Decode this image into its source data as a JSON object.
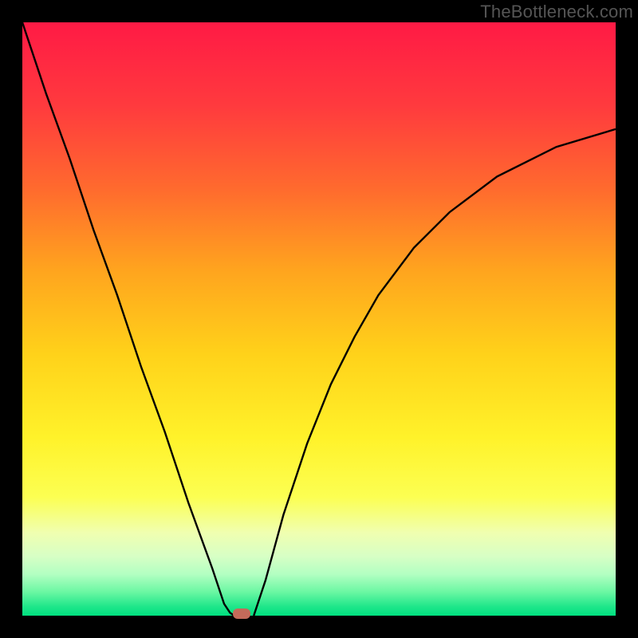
{
  "watermark": "TheBottleneck.com",
  "chart_data": {
    "type": "line",
    "title": "",
    "xlabel": "",
    "ylabel": "",
    "x_range": [
      0,
      100
    ],
    "y_range": [
      0,
      100
    ],
    "series": [
      {
        "name": "curve-left",
        "x": [
          0,
          4,
          8,
          12,
          16,
          20,
          24,
          28,
          32,
          34,
          35,
          35.7
        ],
        "values": [
          100,
          88,
          77,
          65,
          54,
          42,
          31,
          19,
          8,
          2,
          0.5,
          0
        ]
      },
      {
        "name": "curve-right",
        "x": [
          39,
          41,
          44,
          48,
          52,
          56,
          60,
          66,
          72,
          80,
          90,
          100
        ],
        "values": [
          0,
          6,
          17,
          29,
          39,
          47,
          54,
          62,
          68,
          74,
          79,
          82
        ]
      }
    ],
    "gradient_stops": [
      {
        "offset": 0.0,
        "color": "#ff1a45"
      },
      {
        "offset": 0.14,
        "color": "#ff3a3e"
      },
      {
        "offset": 0.28,
        "color": "#ff6a2e"
      },
      {
        "offset": 0.42,
        "color": "#ffa51e"
      },
      {
        "offset": 0.56,
        "color": "#ffd21a"
      },
      {
        "offset": 0.7,
        "color": "#fff22a"
      },
      {
        "offset": 0.8,
        "color": "#fcff52"
      },
      {
        "offset": 0.86,
        "color": "#f0ffb0"
      },
      {
        "offset": 0.9,
        "color": "#d7ffc5"
      },
      {
        "offset": 0.93,
        "color": "#b3ffc2"
      },
      {
        "offset": 0.96,
        "color": "#6bf7a3"
      },
      {
        "offset": 0.985,
        "color": "#1ee68a"
      },
      {
        "offset": 1.0,
        "color": "#00e080"
      }
    ],
    "marker": {
      "x": 37,
      "y": 0,
      "color": "#c46a5a"
    }
  }
}
